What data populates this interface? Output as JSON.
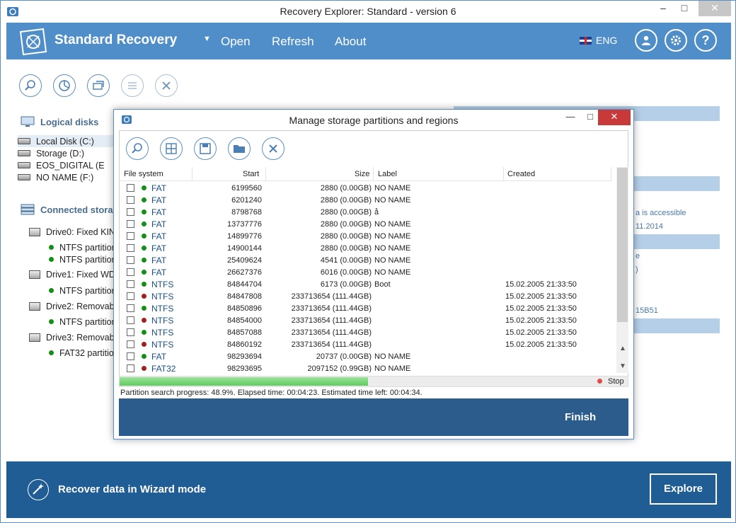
{
  "window": {
    "title": "Recovery Explorer: Standard - version 6",
    "close_glyph": "✕",
    "min_glyph": "–",
    "max_glyph": "□"
  },
  "header": {
    "brand": "Standard Recovery",
    "menu": [
      "Open",
      "Refresh",
      "About"
    ],
    "language": "ENG",
    "icons": [
      "user-icon",
      "gear-icon",
      "help-icon"
    ],
    "help_glyph": "?"
  },
  "left": {
    "logical_heading": "Logical disks",
    "logical_disks": [
      "Local Disk (C:)",
      "Storage (D:)",
      "EOS_DIGITAL (E",
      "NO NAME (F:)"
    ],
    "connected_heading": "Connected stora",
    "drives": [
      {
        "label": "Drive0: Fixed KIN",
        "partitions": [
          "NTFS partition",
          "NTFS partition"
        ]
      },
      {
        "label": "Drive1: Fixed WD",
        "partitions": [
          "NTFS partition"
        ]
      },
      {
        "label": "Drive2: Removab",
        "partitions": [
          "NTFS partition"
        ]
      },
      {
        "label": "Drive3: Removab",
        "partitions": [
          "FAT32 partitio"
        ]
      }
    ]
  },
  "right": {
    "text1": "a is accessible",
    "text2": "11.2014",
    "text3": "e",
    "text4": ")",
    "text5": "15B51"
  },
  "dialog": {
    "title": "Manage storage partitions and regions",
    "columns": [
      "File system",
      "Start",
      "Size",
      "Label",
      "Created"
    ],
    "rows": [
      {
        "fs": "FAT",
        "status": "green",
        "start": "6199560",
        "size": "2880 (0.00GB)",
        "label": "NO NAME",
        "created": ""
      },
      {
        "fs": "FAT",
        "status": "green",
        "start": "6201240",
        "size": "2880 (0.00GB)",
        "label": "NO NAME",
        "created": ""
      },
      {
        "fs": "FAT",
        "status": "green",
        "start": "8798768",
        "size": "2880 (0.00GB)",
        "label": "å",
        "created": ""
      },
      {
        "fs": "FAT",
        "status": "green",
        "start": "13737776",
        "size": "2880 (0.00GB)",
        "label": "NO NAME",
        "created": ""
      },
      {
        "fs": "FAT",
        "status": "green",
        "start": "14899776",
        "size": "2880 (0.00GB)",
        "label": "NO NAME",
        "created": ""
      },
      {
        "fs": "FAT",
        "status": "green",
        "start": "14900144",
        "size": "2880 (0.00GB)",
        "label": "NO NAME",
        "created": ""
      },
      {
        "fs": "FAT",
        "status": "green",
        "start": "25409624",
        "size": "4541 (0.00GB)",
        "label": "NO NAME",
        "created": ""
      },
      {
        "fs": "FAT",
        "status": "green",
        "start": "26627376",
        "size": "6016 (0.00GB)",
        "label": "NO NAME",
        "created": ""
      },
      {
        "fs": "NTFS",
        "status": "green",
        "start": "84844704",
        "size": "6173 (0.00GB)",
        "label": "Boot",
        "created": "15.02.2005 21:33:50"
      },
      {
        "fs": "NTFS",
        "status": "red",
        "start": "84847808",
        "size": "233713654 (111.44GB)",
        "label": "",
        "created": "15.02.2005 21:33:50"
      },
      {
        "fs": "NTFS",
        "status": "green",
        "start": "84850896",
        "size": "233713654 (111.44GB)",
        "label": "",
        "created": "15.02.2005 21:33:50"
      },
      {
        "fs": "NTFS",
        "status": "red",
        "start": "84854000",
        "size": "233713654 (111.44GB)",
        "label": "",
        "created": "15.02.2005 21:33:50"
      },
      {
        "fs": "NTFS",
        "status": "green",
        "start": "84857088",
        "size": "233713654 (111.44GB)",
        "label": "",
        "created": "15.02.2005 21:33:50"
      },
      {
        "fs": "NTFS",
        "status": "red",
        "start": "84860192",
        "size": "233713654 (111.44GB)",
        "label": "",
        "created": "15.02.2005 21:33:50"
      },
      {
        "fs": "FAT",
        "status": "green",
        "start": "98293694",
        "size": "20737 (0.00GB)",
        "label": "NO NAME",
        "created": ""
      },
      {
        "fs": "FAT32",
        "status": "red",
        "start": "98293695",
        "size": "2097152 (0.99GB)",
        "label": "NO NAME",
        "created": ""
      }
    ],
    "progress_fraction": 0.489,
    "progress_text": "Partition search progress: 48.9%. Elapsed time: 00:04:23. Estimated time left: 00:04:34.",
    "stop_label": "Stop",
    "finish_label": "Finish",
    "close_glyph": "✕",
    "min_glyph": "—",
    "max_glyph": "□"
  },
  "footer": {
    "wizard_label": "Recover data in Wizard mode",
    "explore_label": "Explore"
  },
  "colors": {
    "accent": "#4f8ec9",
    "footer": "#1f5d94",
    "dialog_footer": "#2c5c8c",
    "ok": "#138f14",
    "bad": "#a02020"
  }
}
